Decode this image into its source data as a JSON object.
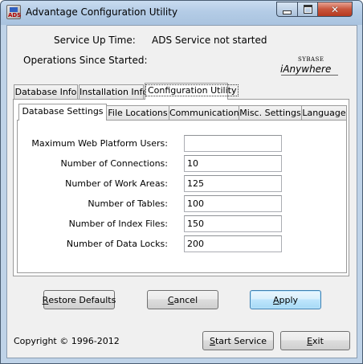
{
  "window": {
    "title": "Advantage Configuration Utility",
    "app_icon_text": "ADS"
  },
  "header": {
    "service_up_time_label": "Service Up Time:",
    "service_up_time_value": "ADS Service not started",
    "operations_label": "Operations Since Started:",
    "logo_small": "SYBASE",
    "logo_main": "iAnywhere"
  },
  "main_tabs": [
    {
      "label": "Database Info"
    },
    {
      "label": "Installation Info"
    },
    {
      "label": "Configuration Utility"
    }
  ],
  "sub_tabs": [
    {
      "label": "Database Settings"
    },
    {
      "label": "File Locations"
    },
    {
      "label": "Communications"
    },
    {
      "label": "Misc. Settings"
    },
    {
      "label": "Language"
    }
  ],
  "settings": {
    "max_web_users_label": "Maximum Web Platform Users:",
    "max_web_users_value": "",
    "connections_label": "Number of Connections:",
    "connections_value": "10",
    "work_areas_label": "Number of Work Areas:",
    "work_areas_value": "125",
    "tables_label": "Number of Tables:",
    "tables_value": "100",
    "index_files_label": "Number of Index Files:",
    "index_files_value": "150",
    "data_locks_label": "Number of Data Locks:",
    "data_locks_value": "200"
  },
  "buttons": {
    "restore_defaults_key": "R",
    "restore_defaults_rest": "estore Defaults",
    "cancel_key": "C",
    "cancel_rest": "ancel",
    "apply_key": "A",
    "apply_rest": "pply",
    "start_service_key": "S",
    "start_service_rest": "tart Service",
    "exit_key": "E",
    "exit_rest": "xit"
  },
  "footer": {
    "copyright": "Copyright © 1996-2012"
  }
}
